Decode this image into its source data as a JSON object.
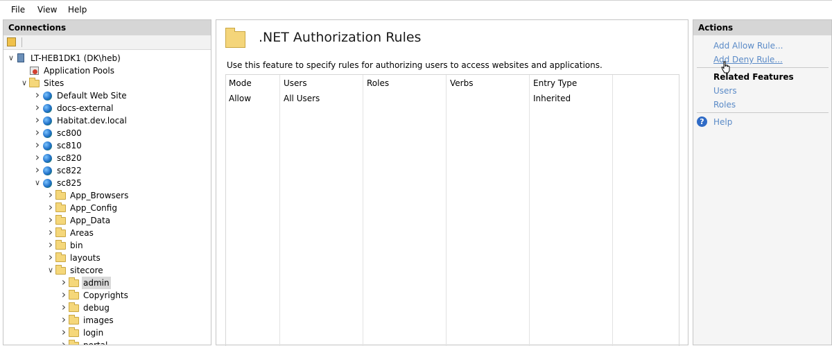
{
  "menu": [
    "File",
    "View",
    "Help"
  ],
  "connections": {
    "header": "Connections",
    "tree": [
      {
        "label": "LT-HEB1DK1 (DK\\heb)",
        "icon": "server-icon",
        "level": 0,
        "state": "expanded"
      },
      {
        "label": "Application Pools",
        "icon": "app-pools-icon",
        "level": 1,
        "state": "none"
      },
      {
        "label": "Sites",
        "icon": "sites-folder-icon",
        "level": 1,
        "state": "expanded"
      },
      {
        "label": "Default Web Site",
        "icon": "website-icon",
        "level": 2,
        "state": "collapsed"
      },
      {
        "label": "docs-external",
        "icon": "website-icon",
        "level": 2,
        "state": "collapsed"
      },
      {
        "label": "Habitat.dev.local",
        "icon": "website-icon",
        "level": 2,
        "state": "collapsed"
      },
      {
        "label": "sc800",
        "icon": "website-icon",
        "level": 2,
        "state": "collapsed"
      },
      {
        "label": "sc810",
        "icon": "website-icon",
        "level": 2,
        "state": "collapsed"
      },
      {
        "label": "sc820",
        "icon": "website-icon",
        "level": 2,
        "state": "collapsed"
      },
      {
        "label": "sc822",
        "icon": "website-icon",
        "level": 2,
        "state": "collapsed"
      },
      {
        "label": "sc825",
        "icon": "website-icon",
        "level": 2,
        "state": "expanded"
      },
      {
        "label": "App_Browsers",
        "icon": "folder-icon",
        "level": 3,
        "state": "collapsed"
      },
      {
        "label": "App_Config",
        "icon": "folder-icon",
        "level": 3,
        "state": "collapsed"
      },
      {
        "label": "App_Data",
        "icon": "folder-icon",
        "level": 3,
        "state": "collapsed"
      },
      {
        "label": "Areas",
        "icon": "folder-icon",
        "level": 3,
        "state": "collapsed"
      },
      {
        "label": "bin",
        "icon": "folder-icon",
        "level": 3,
        "state": "collapsed"
      },
      {
        "label": "layouts",
        "icon": "folder-icon",
        "level": 3,
        "state": "collapsed"
      },
      {
        "label": "sitecore",
        "icon": "folder-icon",
        "level": 3,
        "state": "expanded"
      },
      {
        "label": "admin",
        "icon": "folder-icon",
        "level": 4,
        "state": "collapsed",
        "selected": true
      },
      {
        "label": "Copyrights",
        "icon": "folder-icon",
        "level": 4,
        "state": "collapsed"
      },
      {
        "label": "debug",
        "icon": "folder-icon",
        "level": 4,
        "state": "collapsed"
      },
      {
        "label": "images",
        "icon": "folder-icon",
        "level": 4,
        "state": "collapsed"
      },
      {
        "label": "login",
        "icon": "folder-icon",
        "level": 4,
        "state": "collapsed"
      },
      {
        "label": "portal",
        "icon": "folder-icon",
        "level": 4,
        "state": "collapsed"
      }
    ]
  },
  "main": {
    "title": ".NET Authorization Rules",
    "description": "Use this feature to specify rules for authorizing users to access websites and applications.",
    "columns": [
      "Mode",
      "Users",
      "Roles",
      "Verbs",
      "Entry Type"
    ],
    "rows": [
      [
        "Allow",
        "All Users",
        "",
        "",
        "Inherited"
      ]
    ]
  },
  "actions": {
    "header": "Actions",
    "add_allow": "Add Allow Rule...",
    "add_deny": "Add Deny Rule...",
    "related_header": "Related Features",
    "users": "Users",
    "roles": "Roles",
    "help": "Help"
  }
}
